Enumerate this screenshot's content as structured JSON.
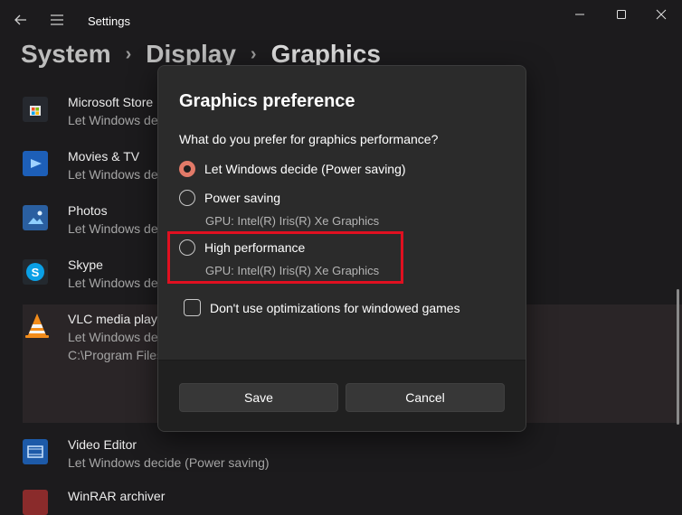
{
  "window": {
    "title": "Settings",
    "back_icon": "arrow-left-icon",
    "menu_icon": "hamburger-icon",
    "controls": [
      "minimize-icon",
      "maximize-icon",
      "close-icon"
    ]
  },
  "breadcrumb": [
    "System",
    "Display",
    "Graphics"
  ],
  "apps": [
    {
      "name": "Microsoft Store",
      "subtitle": "Let Windows decide (Power saving)"
    },
    {
      "name": "Movies & TV",
      "subtitle": "Let Windows decide (Power saving)"
    },
    {
      "name": "Photos",
      "subtitle": "Let Windows decide (Power saving)"
    },
    {
      "name": "Skype",
      "subtitle": "Let Windows decide (Power saving)"
    },
    {
      "name": "VLC media player",
      "subtitle": "Let Windows decide (Power saving)",
      "path": "C:\\Program Files"
    },
    {
      "name": "Video Editor",
      "subtitle": "Let Windows decide (Power saving)"
    },
    {
      "name": "WinRAR archiver",
      "subtitle": ""
    }
  ],
  "dialog": {
    "title": "Graphics preference",
    "question": "What do you prefer for graphics performance?",
    "options": [
      {
        "label": "Let Windows decide (Power saving)",
        "selected": true
      },
      {
        "label": "Power saving",
        "gpu": "GPU: Intel(R) Iris(R) Xe Graphics",
        "selected": false
      },
      {
        "label": "High performance",
        "gpu": "GPU: Intel(R) Iris(R) Xe Graphics",
        "selected": false
      }
    ],
    "checkbox_label": "Don't use optimizations for windowed games",
    "checkbox_checked": false,
    "save_label": "Save",
    "cancel_label": "Cancel"
  },
  "colors": {
    "accent": "#e27a68",
    "highlight": "#e01020",
    "background": "#1c1b1d",
    "dialog": "#2b2b2b"
  }
}
